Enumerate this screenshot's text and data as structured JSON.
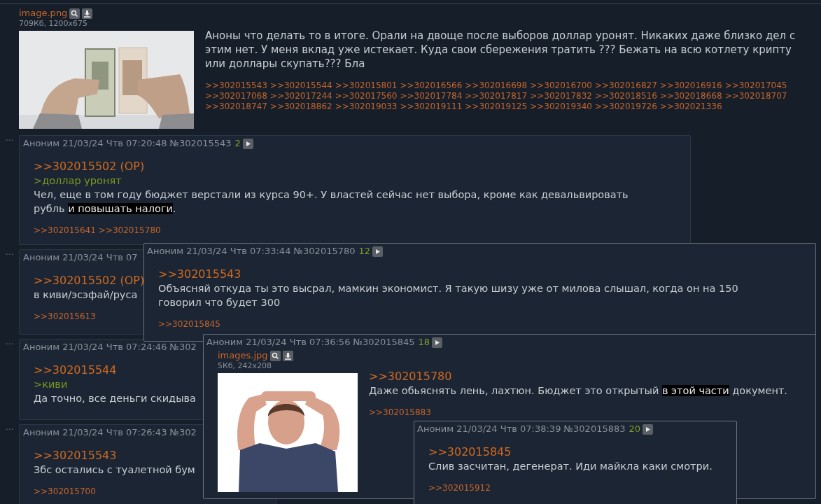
{
  "op": {
    "file": {
      "name": "image.png",
      "meta": "709Кб, 1200x675"
    },
    "image": {
      "kind": "picture"
    },
    "body": [
      {
        "kind": "text",
        "segments": [
          {
            "text": "Аноны что делать то в итоге. Орали на двоще после выборов доллар уронят. Никаких даже близко дел с этим нет. У меня вклад уже истекает. Куда свои сбережения тратить ??? Бежать на всю котлету крипту или доллары скупать??? Бла",
            "spoiler": false
          }
        ]
      }
    ],
    "replies": [
      ">>302015543",
      ">>302015544",
      ">>302015801",
      ">>302016566",
      ">>302016698",
      ">>302016700",
      ">>302016827",
      ">>302016916",
      ">>302017045",
      ">>302017068",
      ">>302017244",
      ">>302017560",
      ">>302017784",
      ">>302017817",
      ">>302017832",
      ">>302018516",
      ">>302018668",
      ">>302018707",
      ">>302018747",
      ">>302018862",
      ">>302019033",
      ">>302019111",
      ">>302019125",
      ">>302019340",
      ">>302019726",
      ">>302021336"
    ]
  },
  "posts": [
    {
      "menu": "⋯",
      "header": "Аноним 21/03/24 Чтв 07:20:48 №302015543",
      "count": "2",
      "body": [
        {
          "kind": "reply_link",
          "text": ">>302015502 (OP)"
        },
        {
          "kind": "greentext",
          "text": ">доллар уронят"
        },
        {
          "kind": "text",
          "segments": [
            {
              "text": "Чел, еще в том году бюджет верстали из курса 90+. У властей сейчас нет выбора, кроме как девальвировать рубль ",
              "spoiler": false
            },
            {
              "text": "и повышать налоги",
              "spoiler": true
            },
            {
              "text": ".",
              "spoiler": false
            }
          ]
        }
      ],
      "replies": [
        ">>302015641",
        ">>302015780"
      ]
    },
    {
      "menu": "⋯",
      "header": "Аноним 21/03/24 Чтв 07",
      "body": [
        {
          "kind": "reply_link",
          "text": ">>302015502 (OP)"
        },
        {
          "kind": "text",
          "segments": [
            {
              "text": "в киви/эсэфай/руса",
              "spoiler": false
            }
          ]
        }
      ],
      "replies": [
        ">>302015613"
      ]
    },
    {
      "menu": "⋯",
      "header": "Аноним 21/03/24 Чтв 07:24:46 №302",
      "body": [
        {
          "kind": "reply_link",
          "text": ">>302015544"
        },
        {
          "kind": "greentext",
          "text": ">киви"
        },
        {
          "kind": "text",
          "segments": [
            {
              "text": "Да точно, все деньги скидыва",
              "spoiler": false
            }
          ]
        }
      ]
    },
    {
      "menu": "⋯",
      "header": "Аноним 21/03/24 Чтв 07:26:43 №302",
      "body": [
        {
          "kind": "reply_link",
          "text": ">>302015543"
        },
        {
          "kind": "text",
          "segments": [
            {
              "text": "Збс остались с туалетной бум",
              "spoiler": false
            }
          ]
        }
      ],
      "replies": [
        ">>302015700"
      ]
    }
  ],
  "popups": [
    {
      "header": "Аноним 21/03/24 Чтв 07:33:44 №302015780",
      "count": "12",
      "body": [
        {
          "kind": "reply_link",
          "text": ">>302015543"
        },
        {
          "kind": "text",
          "segments": [
            {
              "text": "Объясняй откуда ты это высрал, мамкин экономист. Я такую шизу уже от милова слышал, когда он на 150 говорил что будет 300",
              "spoiler": false
            }
          ]
        }
      ],
      "replies": [
        ">>302015845"
      ]
    },
    {
      "header": "Аноним 21/03/24 Чтв 07:36:56 №302015845",
      "count": "18",
      "file": {
        "name": "images.jpg",
        "meta": "5Кб, 242x208"
      },
      "image": {
        "kind": "picture"
      },
      "body": [
        {
          "kind": "reply_link",
          "text": ">>302015780"
        },
        {
          "kind": "text",
          "segments": [
            {
              "text": "Даже обьяснять лень, лахтюн. Бюджет это открытый ",
              "spoiler": false
            },
            {
              "text": "в этой части",
              "spoiler": true
            },
            {
              "text": " документ.",
              "spoiler": false
            }
          ]
        }
      ],
      "replies": [
        ">>302015883"
      ]
    },
    {
      "header": "Аноним 21/03/24 Чтв 07:38:39 №302015883",
      "count": "20",
      "body": [
        {
          "kind": "reply_link",
          "text": ">>302015845"
        },
        {
          "kind": "text",
          "segments": [
            {
              "text": "Слив засчитан, дегенерат. Иди майкла каки смотри.",
              "spoiler": false
            }
          ]
        }
      ],
      "replies": [
        ">>302015912"
      ]
    }
  ]
}
